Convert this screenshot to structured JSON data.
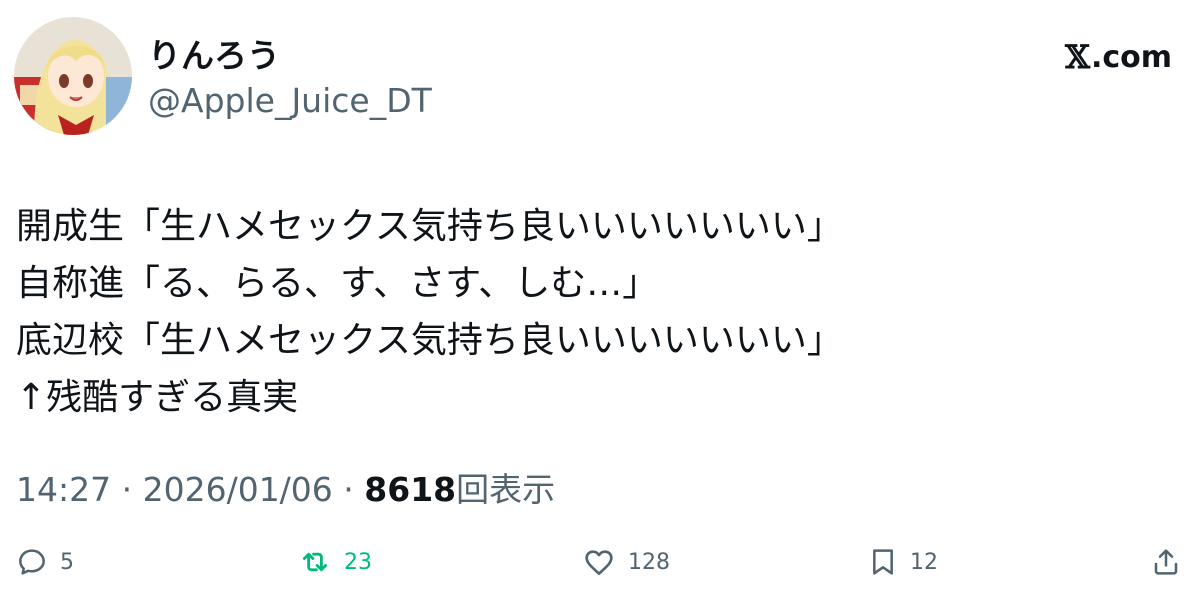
{
  "author": {
    "display_name": "りんろう",
    "handle": "@Apple_Juice_DT"
  },
  "brand": {
    "mark": "𝕏",
    "suffix": ".com"
  },
  "tweet": {
    "lines": [
      "開成生「生ハメセックス気持ち良いいいいいいい」",
      "自称進「る、らる、す、さす、しむ…」",
      "底辺校「生ハメセックス気持ち良いいいいいいい」",
      "↑残酷すぎる真実"
    ]
  },
  "meta": {
    "time": "14:27",
    "separator": " · ",
    "date": "2026/01/06",
    "views_count": "8618",
    "views_label": "回表示"
  },
  "actions": {
    "replies": "5",
    "reposts": "23",
    "likes": "128",
    "bookmarks": "12"
  },
  "icons": {
    "reply": "reply-icon",
    "repost": "repost-icon",
    "like": "heart-icon",
    "bookmark": "bookmark-icon",
    "share": "share-icon"
  },
  "colors": {
    "text_primary": "#0f1419",
    "text_secondary": "#536471",
    "repost_active": "#00ba7c"
  }
}
